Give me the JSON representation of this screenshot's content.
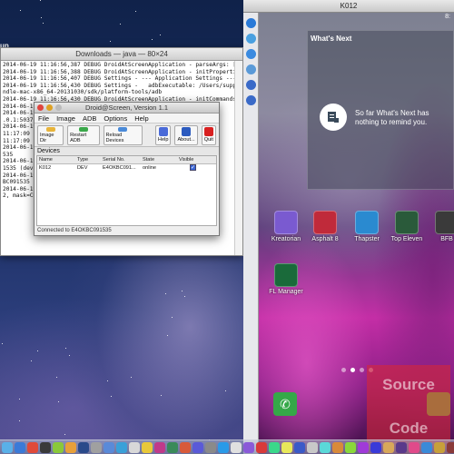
{
  "desktop": {
    "finder_label": "up"
  },
  "terminal": {
    "title": "Downloads — java — 80×24",
    "lines": [
      "2014-06-19 11:16:56,387 DEBUG DroidAtScreenApplication - parseArgs: []",
      "2014-06-19 11:16:56,388 DEBUG DroidAtScreenApplication - initProperties",
      "2014-06-19 11:16:56,407 DEBUG Settings - --- Application Settings ---",
      "2014-06-19 11:16:56,430 DEBUG Settings -   adbExecutable: /Users/suppakit/adt-bu",
      "ndle-mac-x86_64-20131030/sdk/platform-tools/adb",
      "2014-06-19 11:16:56,430 DEBUG DroidAtScreenApplication - initCommands",
      "2014-06-19 11:16:56,438 DEBUG DroidAtScreenApplication - initGUI",
      "2014-06-19",
      ".0.1:5037",
      "2014-06-19",
      "11:17:09 E/",
      "11:17:09 E/",
      "2014-06-19",
      "535",
      "2014-06-19",
      "1535 (device",
      "2014-06-19",
      "BC091535 (d",
      "2014-06-19",
      "2, mask=CHA"
    ]
  },
  "droid": {
    "title": "Droid@Screen, Version 1.1",
    "menu": [
      "File",
      "Image",
      "ADB",
      "Options",
      "Help"
    ],
    "toolbar": [
      {
        "label": "Image Dir",
        "icon": "folder-icon",
        "color": "#e8b43a"
      },
      {
        "label": "Restart ADB",
        "icon": "restart-icon",
        "color": "#3aa84a"
      },
      {
        "label": "Reload Devices",
        "icon": "reload-icon",
        "color": "#4a8ad8"
      },
      {
        "label": "Help",
        "icon": "help-icon",
        "color": "#4a6ad8"
      },
      {
        "label": "About...",
        "icon": "info-icon",
        "color": "#2c5bbf"
      },
      {
        "label": "Quit",
        "icon": "power-icon",
        "color": "#d82020"
      }
    ],
    "group_label": "Devices",
    "columns": [
      "Name",
      "Type",
      "Serial No.",
      "State",
      "Visible"
    ],
    "rows": [
      {
        "name": "K012",
        "type": "DEV",
        "serial": "E4OKBC091...",
        "state": "online",
        "visible": true
      }
    ],
    "status": "Connected to E4OKBC091535"
  },
  "android": {
    "window_title": "K012",
    "status_time": "8:",
    "card": {
      "title": "What's Next",
      "text": "So far What's Next has nothing to remind you."
    },
    "apps": [
      {
        "label": "Kreatorian",
        "color": "#7a5ad0"
      },
      {
        "label": "Asphalt 8",
        "color": "#c02a3a"
      },
      {
        "label": "Thapster",
        "color": "#2a8ad0"
      },
      {
        "label": "Top Eleven",
        "color": "#2a5a3a"
      },
      {
        "label": "BFB",
        "color": "#3a3a3a"
      },
      {
        "label": "FL Manager",
        "color": "#1a6a3a"
      }
    ]
  },
  "watermark": {
    "line1": "Source",
    "line2": "Code"
  },
  "dock_colors": [
    "#5ab0e8",
    "#3a7ad8",
    "#e04a3a",
    "#3a3a3a",
    "#8ac83a",
    "#e8a03a",
    "#2a4a8a",
    "#a0a0a0",
    "#5a8ad8",
    "#3aa0d8",
    "#d8d8d8",
    "#e8c83a",
    "#c03a8a",
    "#3a8a5a",
    "#d85a3a",
    "#5a5ad8",
    "#8a8a8a",
    "#2a9ae8",
    "#e0e0e0",
    "#8a5ad8",
    "#d83a3a",
    "#3ad88a",
    "#e8e85a",
    "#3a5ac8",
    "#c8c8c8",
    "#5ad8d8",
    "#d88a3a",
    "#8ad83a",
    "#a03ad8",
    "#3a3ad8",
    "#d8a85a",
    "#5a3a8a",
    "#e04a8a",
    "#3a8ad8",
    "#c8a03a",
    "#8a3a3a",
    "#3ad8a0",
    "#a0a0e8",
    "#e8a0a0",
    "#5a8a5a",
    "#d85ad8"
  ]
}
